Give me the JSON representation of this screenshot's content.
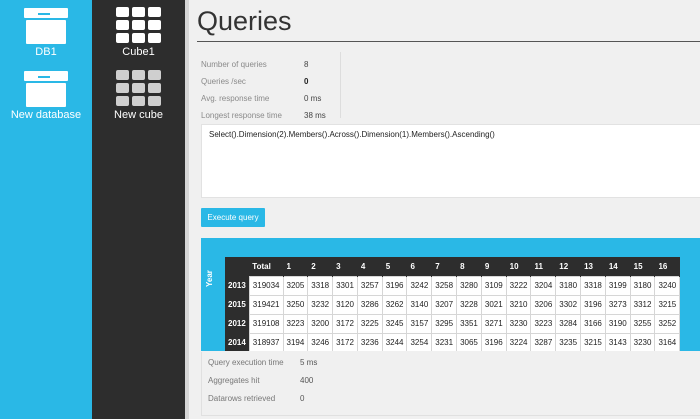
{
  "db_sidebar": {
    "items": [
      {
        "label": "DB1",
        "icon": "database-box-icon"
      },
      {
        "label": "New database",
        "icon": "add-database-box-icon"
      }
    ]
  },
  "cube_sidebar": {
    "items": [
      {
        "label": "Cube1",
        "icon": "cube-grid-icon"
      },
      {
        "label": "New cube",
        "icon": "add-cube-grid-icon"
      }
    ]
  },
  "page": {
    "title": "Queries"
  },
  "stats": [
    {
      "label": "Number of queries",
      "value": "8"
    },
    {
      "label": "Queries /sec",
      "value": "0"
    },
    {
      "label": "Avg. response time",
      "value": "0 ms"
    },
    {
      "label": "Longest response time",
      "value": "38 ms"
    }
  ],
  "query": {
    "text": "Select().Dimension(2).Members().Across().Dimension(1).Members().Ascending()"
  },
  "execute_button": {
    "label": "Execute query"
  },
  "results": {
    "row_dimension": "Year",
    "columns": [
      "Total",
      "1",
      "2",
      "3",
      "4",
      "5",
      "6",
      "7",
      "8",
      "9",
      "10",
      "11",
      "12",
      "13",
      "14",
      "15",
      "16"
    ],
    "rows": [
      {
        "year": "2013",
        "cells": [
          "319034",
          "3205",
          "3318",
          "3301",
          "3257",
          "3196",
          "3242",
          "3258",
          "3280",
          "3109",
          "3222",
          "3204",
          "3180",
          "3318",
          "3199",
          "3180",
          "3240"
        ]
      },
      {
        "year": "2015",
        "cells": [
          "319421",
          "3250",
          "3232",
          "3120",
          "3286",
          "3262",
          "3140",
          "3207",
          "3228",
          "3021",
          "3210",
          "3206",
          "3302",
          "3196",
          "3273",
          "3312",
          "3215"
        ]
      },
      {
        "year": "2012",
        "cells": [
          "319108",
          "3223",
          "3200",
          "3172",
          "3225",
          "3245",
          "3157",
          "3295",
          "3351",
          "3271",
          "3230",
          "3223",
          "3284",
          "3166",
          "3190",
          "3255",
          "3252"
        ]
      },
      {
        "year": "2014",
        "cells": [
          "318937",
          "3194",
          "3246",
          "3172",
          "3236",
          "3244",
          "3254",
          "3231",
          "3065",
          "3196",
          "3224",
          "3287",
          "3235",
          "3215",
          "3143",
          "3230",
          "3164"
        ]
      }
    ]
  },
  "exec_stats": [
    {
      "label": "Query execution time",
      "value": "5 ms"
    },
    {
      "label": "Aggregates hit",
      "value": "400"
    },
    {
      "label": "Datarows retrieved",
      "value": "0"
    }
  ],
  "colors": {
    "accent": "#2ab8e6",
    "dark": "#2d2d2d"
  }
}
